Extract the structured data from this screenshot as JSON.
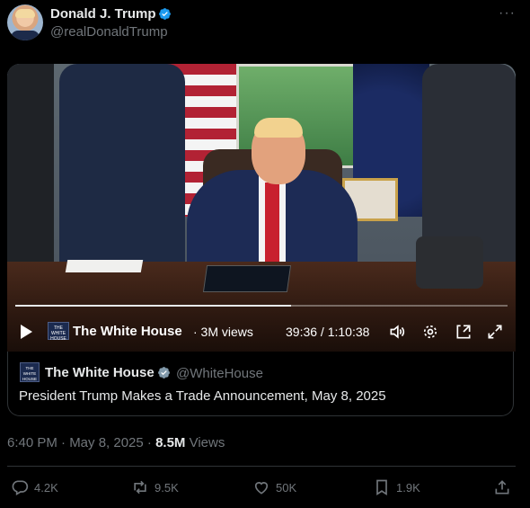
{
  "author": {
    "name": "Donald J. Trump",
    "handle": "@realDonaldTrump",
    "verified": true
  },
  "more_label": "···",
  "video": {
    "channel_logo_text": "THE WHITE HOUSE",
    "channel_name": "The White House",
    "views": "· 3M views",
    "time": "39:36 / 1:10:38",
    "progress": 0.56
  },
  "quote": {
    "logo_text": "THE WHITE HOUSE",
    "name": "The White House",
    "handle": "@WhiteHouse",
    "verified": true,
    "text": "President Trump Makes a Trade Announcement, May 8, 2025"
  },
  "meta": {
    "time": "6:40 PM · May 8, 2025 · ",
    "views_count": "8.5M",
    "views_label": " Views"
  },
  "actions": {
    "replies": "4.2K",
    "reposts": "9.5K",
    "likes": "50K",
    "bookmarks": "1.9K"
  },
  "icons": {
    "verified": "verified-badge-icon",
    "reply": "reply-icon",
    "repost": "repost-icon",
    "like": "heart-icon",
    "bookmark": "bookmark-icon",
    "share": "share-icon"
  },
  "colors": {
    "verified": "#1d9bf0",
    "muted": "#71767b",
    "text": "#e7e9ea"
  }
}
